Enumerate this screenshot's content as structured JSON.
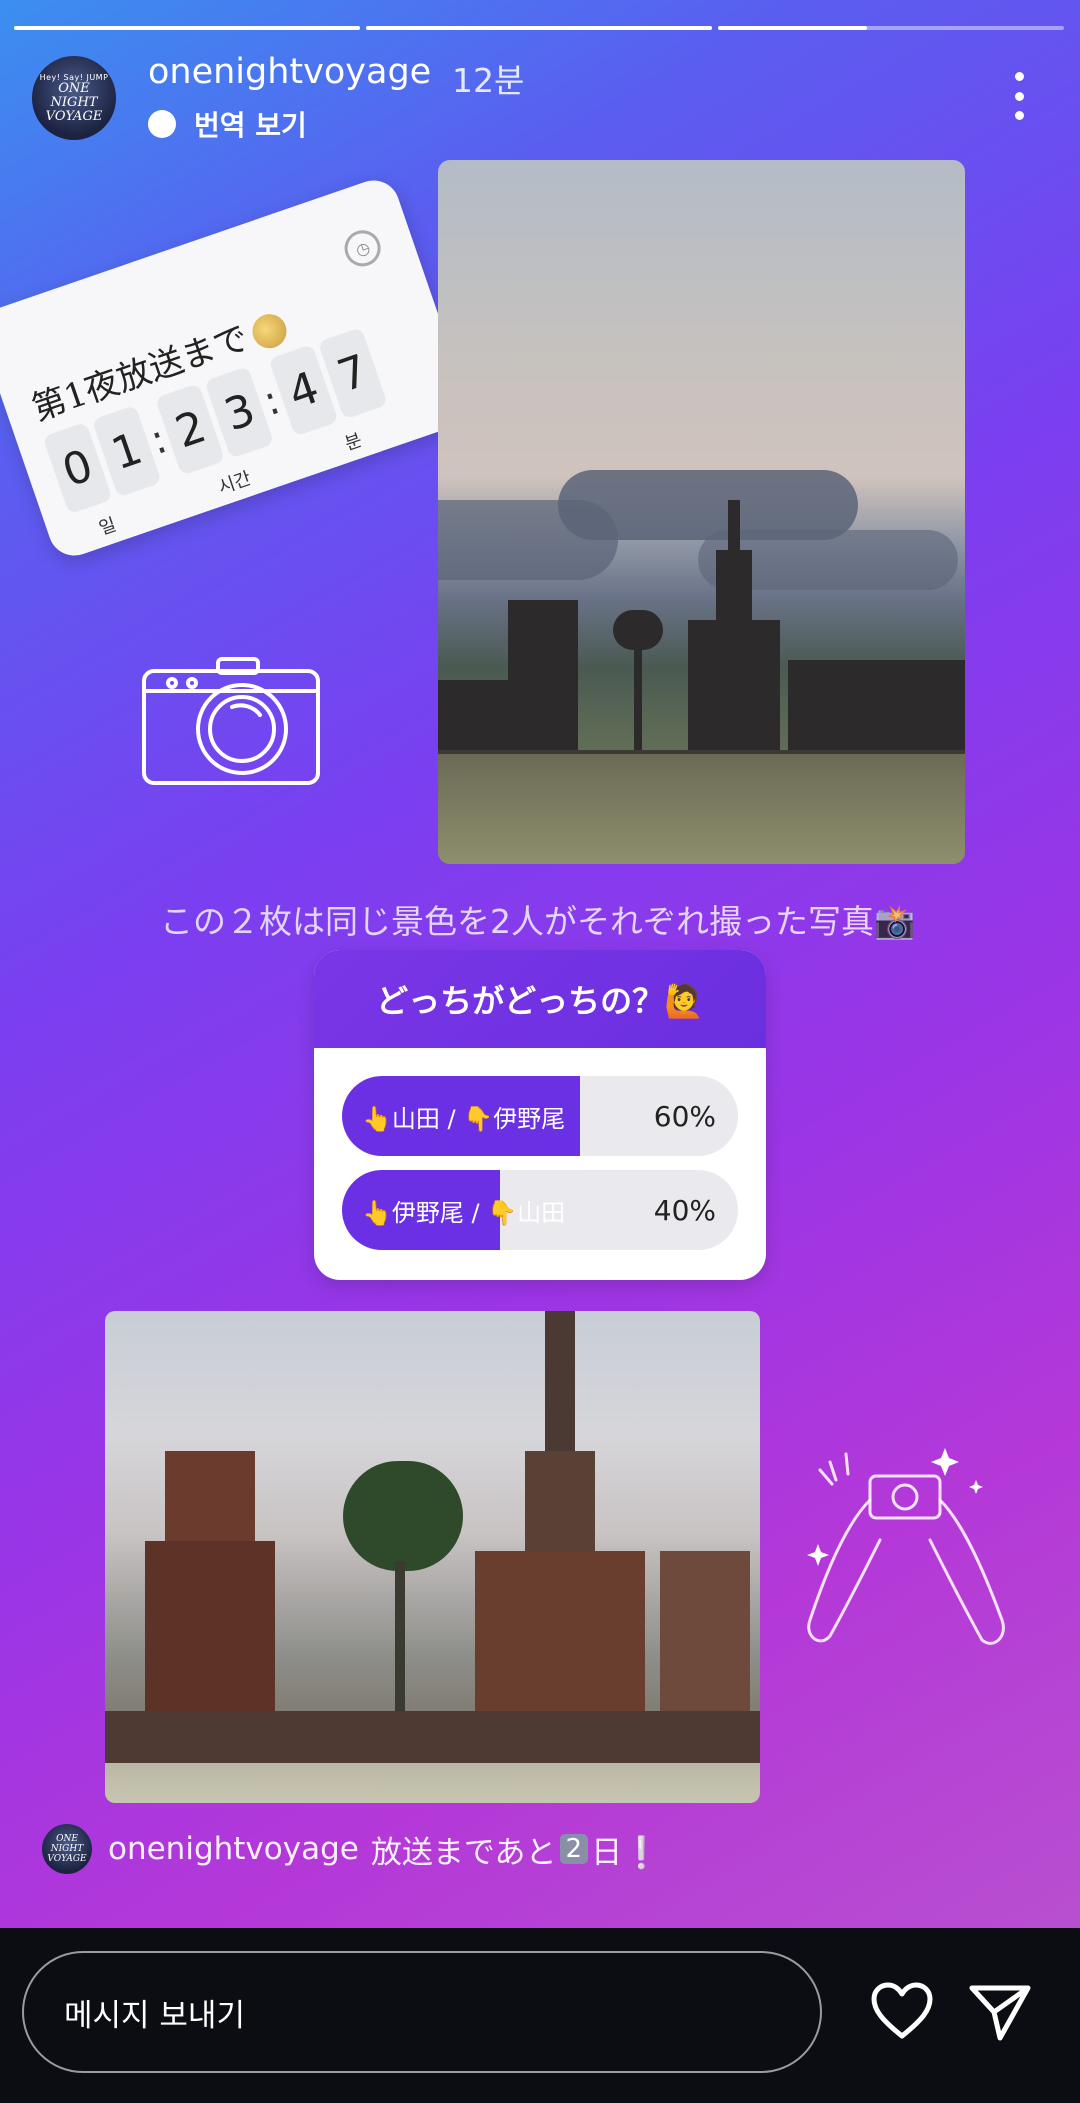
{
  "story": {
    "progress": [
      1.0,
      1.0,
      0.43
    ],
    "account": {
      "username": "onenightvoyage",
      "time_ago": "12분",
      "avatar_top": "Hey! Say! JUMP",
      "avatar_main": "ONE NIGHT VOYAGE"
    },
    "translate_label": "번역 보기",
    "countdown": {
      "title": "第1夜放送まで",
      "digits": [
        "0",
        "1",
        "2",
        "3",
        "4",
        "7"
      ],
      "units": {
        "days": "일",
        "hours": "시간",
        "minutes": "분"
      }
    },
    "caption": "この２枚は同じ景色を2人がそれぞれ撮った写真📸",
    "poll": {
      "question": "どっちがどっちの？🙋",
      "options": [
        {
          "label": "👆山田 / 👇伊野尾",
          "percent_text": "60%",
          "share": 0.6
        },
        {
          "label": "👆伊野尾 / 👇山田",
          "percent_text": "40%",
          "share": 0.4
        }
      ]
    },
    "bottom_caption": {
      "username": "onenightvoyage",
      "text_before": "放送まであと",
      "keycap": "2",
      "text_after": "日❕"
    }
  },
  "footer": {
    "message_placeholder": "메시지 보내기"
  },
  "icons": [
    "more-icon",
    "camera-doodle-icon",
    "hand-camera-doodle-icon",
    "heart-icon",
    "send-icon",
    "moon-icon",
    "clock-icon"
  ]
}
